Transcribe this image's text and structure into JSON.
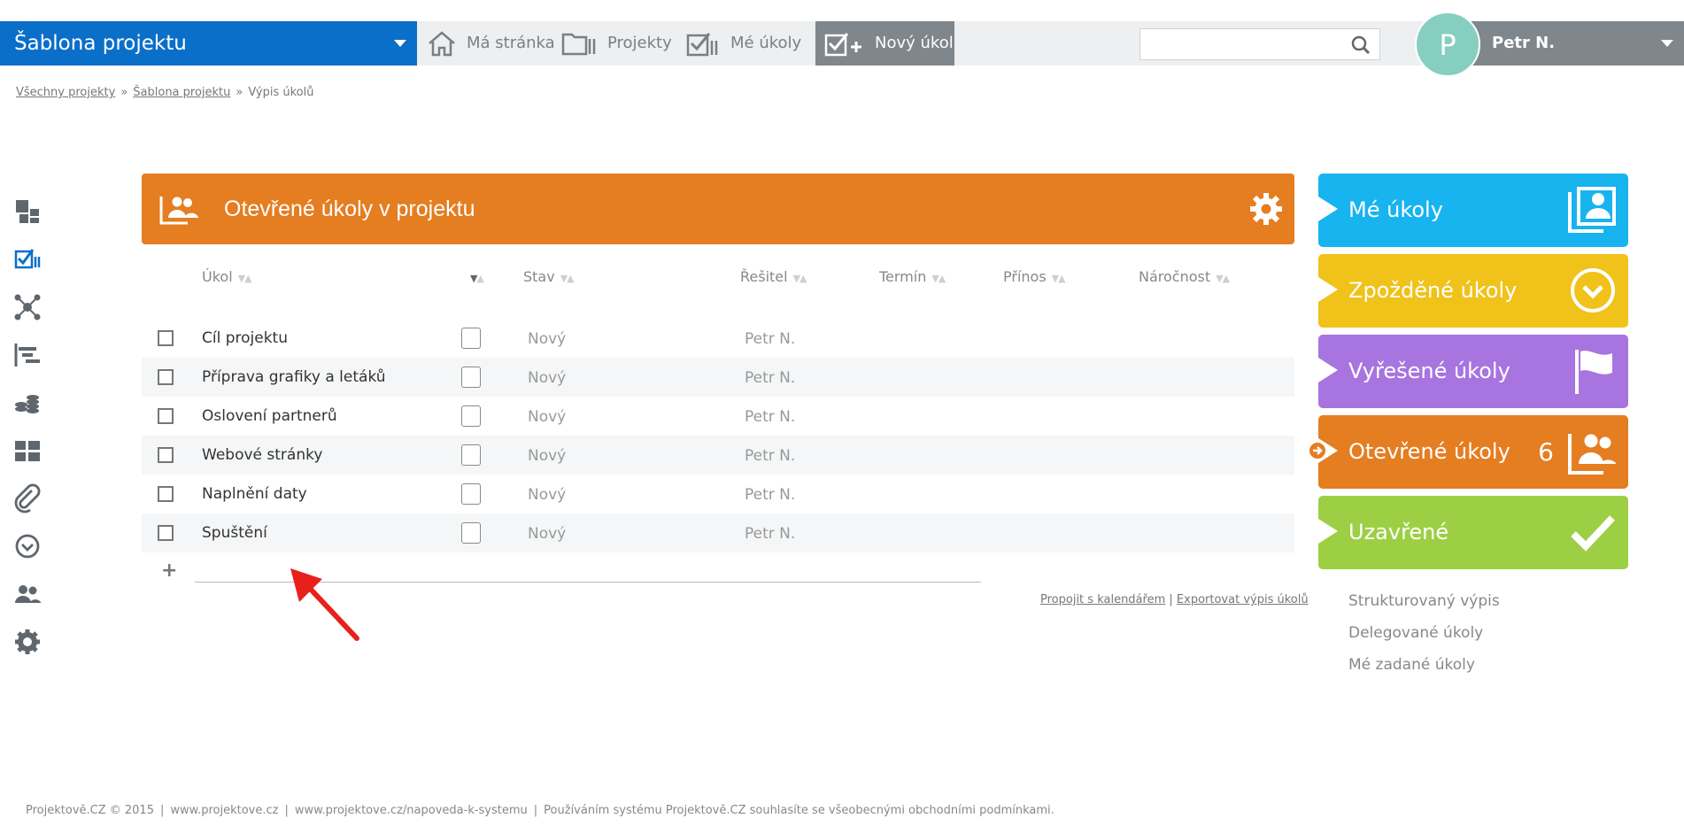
{
  "header": {
    "project_name": "Šablona projektu",
    "nav": [
      {
        "label": "Má stránka",
        "icon": "home-icon"
      },
      {
        "label": "Projekty",
        "icon": "folders-icon"
      },
      {
        "label": "Mé úkoly",
        "icon": "tasks-icon"
      }
    ],
    "new_task_label": "Nový úkol",
    "search_placeholder": "",
    "user_initial": "P",
    "user_name": "Petr N."
  },
  "breadcrumb": [
    "Všechny projekty",
    "Šablona projektu",
    "Výpis úkolů"
  ],
  "breadcrumb_sep": "»",
  "panel": {
    "title": "Otevřené úkoly v projektu"
  },
  "table": {
    "columns": [
      "Úkol",
      "",
      "Stav",
      "Řešitel",
      "Termín",
      "Přínos",
      "Náročnost"
    ],
    "rows": [
      {
        "name": "Cíl projektu",
        "stav": "Nový",
        "resitel": "Petr N."
      },
      {
        "name": "Příprava grafiky a letáků",
        "stav": "Nový",
        "resitel": "Petr N."
      },
      {
        "name": "Oslovení partnerů",
        "stav": "Nový",
        "resitel": "Petr N."
      },
      {
        "name": "Webové stránky",
        "stav": "Nový",
        "resitel": "Petr N."
      },
      {
        "name": "Naplnění daty",
        "stav": "Nový",
        "resitel": "Petr N."
      },
      {
        "name": "Spuštění",
        "stav": "Nový",
        "resitel": "Petr N."
      }
    ],
    "add_symbol": "+"
  },
  "links": {
    "calendar": "Propojit s kalendářem",
    "sep": "|",
    "export": "Exportovat výpis úkolů"
  },
  "cards": [
    {
      "label": "Mé úkoly",
      "color": "#17b4ef"
    },
    {
      "label": "Zpožděné úkoly",
      "color": "#f0c21a"
    },
    {
      "label": "Vyřešené úkoly",
      "color": "#a774e0"
    },
    {
      "label": "Otevřené úkoly",
      "color": "#e57d21",
      "count": "6"
    },
    {
      "label": "Uzavřené",
      "color": "#9dcf45"
    }
  ],
  "sub_links": [
    "Strukturovaný výpis",
    "Delegované úkoly",
    "Mé zadané úkoly"
  ],
  "footer": [
    "Projektově.CZ © 2015",
    "www.projektove.cz",
    "www.projektove.cz/napoveda-k-systemu",
    "Používáním systému Projektově.CZ souhlasíte se všeobecnými obchodními podmínkami."
  ],
  "footer_sep": "|",
  "colors": {
    "header_blue": "#0a6fc9",
    "panel_orange": "#e57d21",
    "avatar_teal": "#86cfc0"
  }
}
